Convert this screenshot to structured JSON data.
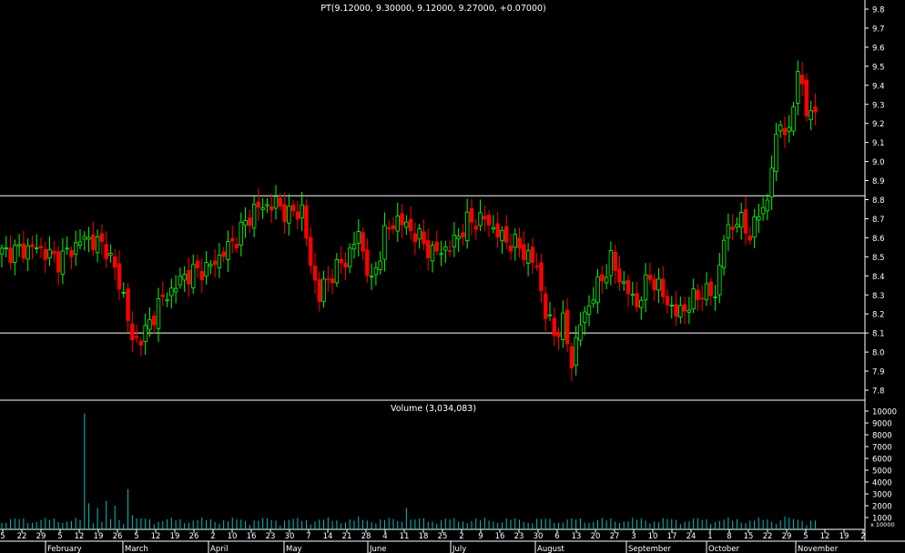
{
  "chart_data": [
    {
      "type": "candlestick",
      "title": "PT(9.12000, 9.30000, 9.12000, 9.27000, +0.07000)",
      "ylim": [
        7.7,
        9.85
      ],
      "y_ticks": [
        "9.8",
        "9.7",
        "9.6",
        "9.5",
        "9.4",
        "9.3",
        "9.2",
        "9.1",
        "9.0",
        "8.9",
        "8.8",
        "8.7",
        "8.6",
        "8.5",
        "8.4",
        "8.3",
        "8.2",
        "8.1",
        "8.0",
        "7.9",
        "7.8"
      ],
      "horizontal_lines": [
        8.82,
        8.1
      ],
      "colors": {
        "up": "#00ff00",
        "down": "#ff0000",
        "volume": "#00c0c0",
        "grid": "#ffffff",
        "text": "#ffffff",
        "background": "#000000"
      },
      "key_points": [
        {
          "day": 0,
          "close": 8.52
        },
        {
          "day": 8,
          "close": 8.55
        },
        {
          "day": 13,
          "close": 8.48
        },
        {
          "day": 19,
          "close": 8.6
        },
        {
          "day": 24,
          "close": 8.55
        },
        {
          "day": 28,
          "close": 8.3
        },
        {
          "day": 30,
          "close": 8.05
        },
        {
          "day": 33,
          "close": 8.1
        },
        {
          "day": 36,
          "close": 8.25
        },
        {
          "day": 42,
          "close": 8.4
        },
        {
          "day": 48,
          "close": 8.45
        },
        {
          "day": 54,
          "close": 8.6
        },
        {
          "day": 58,
          "close": 8.75
        },
        {
          "day": 63,
          "close": 8.78
        },
        {
          "day": 66,
          "close": 8.72
        },
        {
          "day": 69,
          "close": 8.75
        },
        {
          "day": 71,
          "close": 8.45
        },
        {
          "day": 73,
          "close": 8.3
        },
        {
          "day": 76,
          "close": 8.42
        },
        {
          "day": 79,
          "close": 8.48
        },
        {
          "day": 82,
          "close": 8.62
        },
        {
          "day": 85,
          "close": 8.35
        },
        {
          "day": 88,
          "close": 8.62
        },
        {
          "day": 91,
          "close": 8.7
        },
        {
          "day": 95,
          "close": 8.62
        },
        {
          "day": 99,
          "close": 8.52
        },
        {
          "day": 103,
          "close": 8.55
        },
        {
          "day": 107,
          "close": 8.68
        },
        {
          "day": 111,
          "close": 8.7
        },
        {
          "day": 115,
          "close": 8.6
        },
        {
          "day": 119,
          "close": 8.55
        },
        {
          "day": 123,
          "close": 8.45
        },
        {
          "day": 125,
          "close": 8.2
        },
        {
          "day": 127,
          "close": 8.1
        },
        {
          "day": 129,
          "close": 8.15
        },
        {
          "day": 131,
          "close": 7.95
        },
        {
          "day": 133,
          "close": 8.15
        },
        {
          "day": 136,
          "close": 8.3
        },
        {
          "day": 140,
          "close": 8.48
        },
        {
          "day": 143,
          "close": 8.35
        },
        {
          "day": 146,
          "close": 8.25
        },
        {
          "day": 149,
          "close": 8.4
        },
        {
          "day": 152,
          "close": 8.3
        },
        {
          "day": 155,
          "close": 8.2
        },
        {
          "day": 158,
          "close": 8.25
        },
        {
          "day": 161,
          "close": 8.32
        },
        {
          "day": 164,
          "close": 8.3
        },
        {
          "day": 166,
          "close": 8.6
        },
        {
          "day": 169,
          "close": 8.7
        },
        {
          "day": 172,
          "close": 8.62
        },
        {
          "day": 174,
          "close": 8.72
        },
        {
          "day": 176,
          "close": 8.8
        },
        {
          "day": 177,
          "close": 8.98
        },
        {
          "day": 179,
          "close": 9.22
        },
        {
          "day": 181,
          "close": 9.12
        },
        {
          "day": 183,
          "close": 9.5
        },
        {
          "day": 185,
          "close": 9.25
        },
        {
          "day": 187,
          "close": 9.27
        }
      ],
      "x_ticks": [
        "5",
        "22",
        "29",
        "5",
        "12",
        "19",
        "26",
        "5",
        "12",
        "19",
        "26",
        "2",
        "10",
        "16",
        "23",
        "30",
        "7",
        "14",
        "21",
        "28",
        "4",
        "11",
        "18",
        "25",
        "2",
        "9",
        "16",
        "23",
        "30",
        "6",
        "13",
        "20",
        "27",
        "3",
        "10",
        "17",
        "24",
        "1",
        "8",
        "15",
        "22",
        "29",
        "5",
        "12",
        "19",
        "2"
      ],
      "months": [
        "February",
        "March",
        "April",
        "May",
        "June",
        "July",
        "August",
        "September",
        "October",
        "November"
      ]
    },
    {
      "type": "bar",
      "title": "Volume (3,034,083)",
      "units_label": "x 10000",
      "ylim": [
        0,
        10500
      ],
      "y_ticks": [
        "10000",
        "9000",
        "8000",
        "7000",
        "6000",
        "5000",
        "4000",
        "3000",
        "2000",
        "1000"
      ],
      "spikes": [
        {
          "day": 19,
          "value": 9800
        },
        {
          "day": 20,
          "value": 2200
        },
        {
          "day": 22,
          "value": 1800
        },
        {
          "day": 24,
          "value": 2400
        },
        {
          "day": 26,
          "value": 2000
        },
        {
          "day": 29,
          "value": 3400
        },
        {
          "day": 30,
          "value": 1200
        },
        {
          "day": 33,
          "value": 900
        },
        {
          "day": 93,
          "value": 1800
        },
        {
          "day": 82,
          "value": 1100
        },
        {
          "day": 167,
          "value": 1000
        },
        {
          "day": 180,
          "value": 1100
        }
      ]
    }
  ]
}
